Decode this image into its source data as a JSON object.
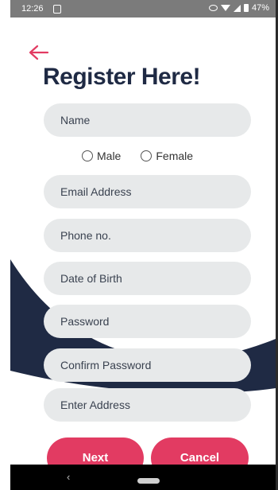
{
  "status_bar": {
    "time": "12:26",
    "battery": "47%"
  },
  "header": {
    "title": "Register Here!"
  },
  "colors": {
    "accent": "#e23b62",
    "dark": "#1f2a44",
    "field_bg": "#e7e9ea"
  },
  "form": {
    "name_placeholder": "Name",
    "gender": {
      "male": "Male",
      "female": "Female"
    },
    "email_placeholder": "Email Address",
    "phone_placeholder": "Phone no.",
    "dob_placeholder": "Date of Birth",
    "password_placeholder": "Password",
    "confirm_password_placeholder": "Confirm Password",
    "address_placeholder": "Enter Address"
  },
  "actions": {
    "next_label": "Next",
    "cancel_label": "Cancel"
  },
  "nav": {
    "back_glyph": "‹"
  }
}
